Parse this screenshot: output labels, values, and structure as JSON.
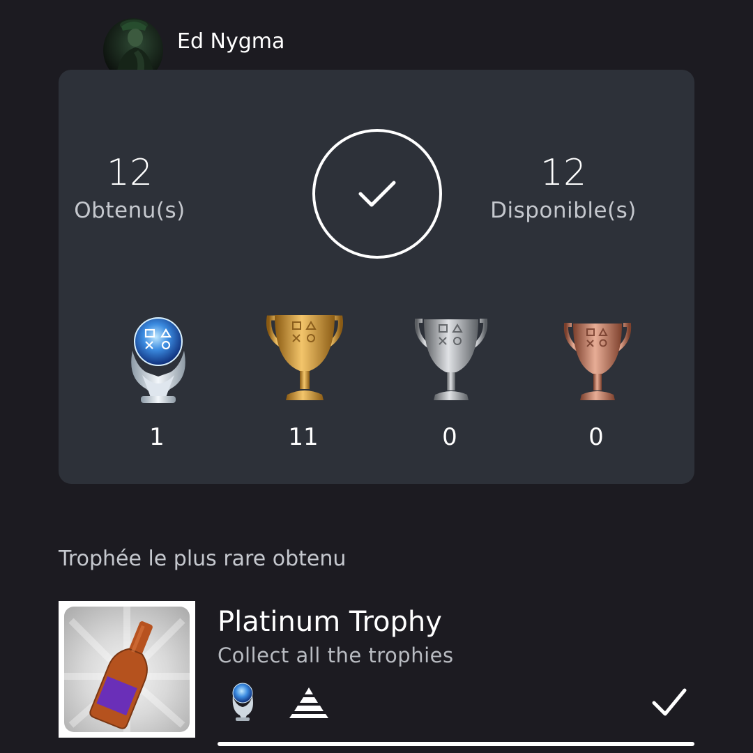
{
  "user": {
    "name": "Ed Nygma"
  },
  "summary": {
    "earned_count": "12",
    "earned_label": "Obtenu(s)",
    "available_count": "12",
    "available_label": "Disponible(s)"
  },
  "trophy_counts": [
    {
      "type": "platinum",
      "count": "1",
      "icon": "platinum-trophy-icon"
    },
    {
      "type": "gold",
      "count": "11",
      "icon": "gold-trophy-icon"
    },
    {
      "type": "silver",
      "count": "0",
      "icon": "silver-trophy-icon"
    },
    {
      "type": "bronze",
      "count": "0",
      "icon": "bronze-trophy-icon"
    }
  ],
  "rarest": {
    "section_title": "Trophée le plus rare obtenu",
    "name": "Platinum Trophy",
    "description": "Collect all the trophies",
    "grade_icon": "platinum-trophy-icon",
    "rarity_icon": "rarity-pyramid-icon",
    "status_icon": "checkmark-icon",
    "progress": 1.0
  },
  "colors": {
    "background": "#1c1b21",
    "card": "#2d3139",
    "text_primary": "#ffffff",
    "text_secondary": "#c5c8ce"
  }
}
